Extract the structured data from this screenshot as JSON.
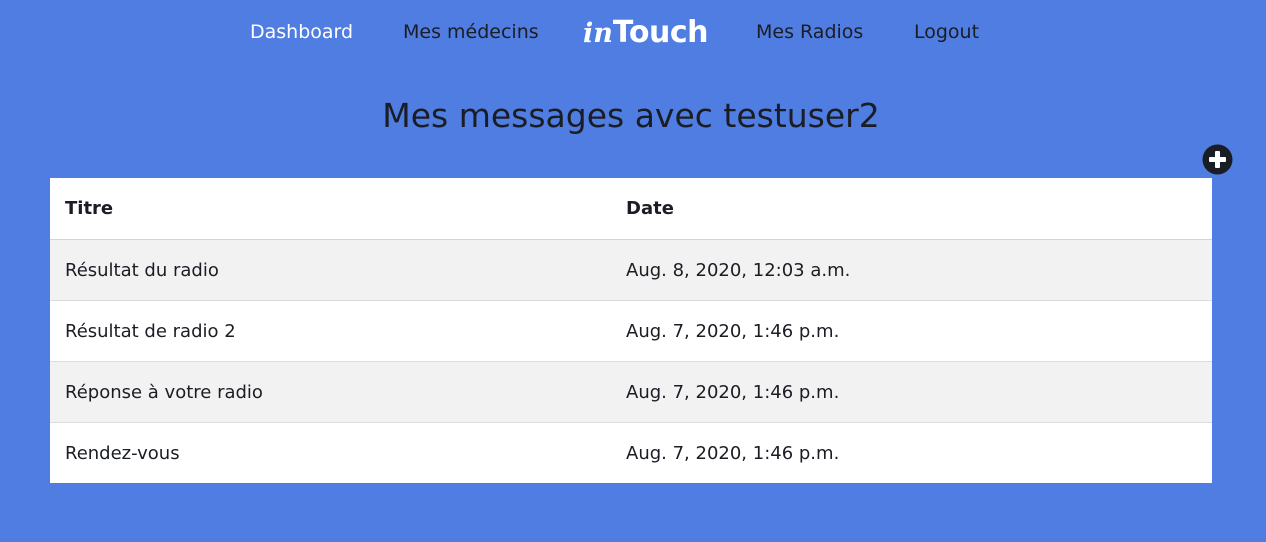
{
  "nav": {
    "dashboard": "Dashboard",
    "medecins": "Mes médecins",
    "logo_prefix": "in",
    "logo_suffix": "Touch",
    "radios": "Mes Radios",
    "logout": "Logout"
  },
  "page": {
    "title": "Mes messages avec testuser2"
  },
  "actions": {
    "add_icon": "plus-circle-icon"
  },
  "table": {
    "headers": {
      "titre": "Titre",
      "date": "Date"
    },
    "rows": [
      {
        "titre": "Résultat du radio",
        "date": "Aug. 8, 2020, 12:03 a.m."
      },
      {
        "titre": "Résultat de radio 2",
        "date": "Aug. 7, 2020, 1:46 p.m."
      },
      {
        "titre": "Réponse à votre radio",
        "date": "Aug. 7, 2020, 1:46 p.m."
      },
      {
        "titre": "Rendez-vous",
        "date": "Aug. 7, 2020, 1:46 p.m."
      }
    ]
  },
  "colors": {
    "background": "#4f7de2",
    "text": "#1b1d24",
    "nav_active": "#ffffff",
    "row_striped": "#f2f2f2",
    "row_plain": "#ffffff"
  }
}
